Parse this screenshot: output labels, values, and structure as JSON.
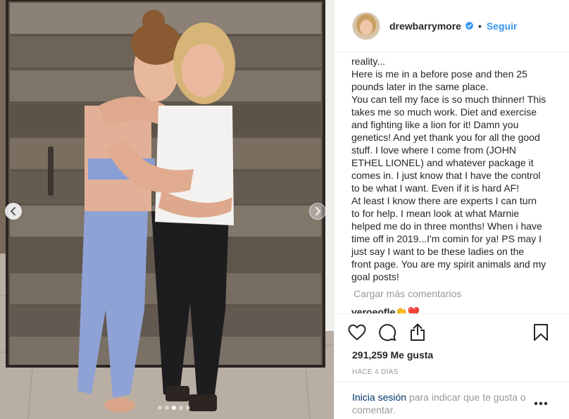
{
  "post": {
    "author": {
      "username": "drewbarrymore",
      "verified": true,
      "follow_label": "Seguir",
      "separator": "•"
    },
    "caption_lines": [
      "reality...",
      "Here is me in a before pose and then 25",
      "pounds later in the same place.",
      "You can tell my face is so much thinner! This",
      "takes me so much work. Diet and exercise",
      "and fighting like a lion for it! Damn you",
      "genetics! And yet thank you for all the good",
      "stuff. I love where I come from (JOHN",
      "ETHEL LIONEL) and whatever package it",
      "comes in. I just know that I have the control",
      "to be what I want. Even if it is hard AF!",
      "At least I know there are experts I can turn",
      "to for help. I mean look at what Marnie",
      "helped me do in three months! When i have",
      "time off in 2019...I'm comin for ya! PS may I",
      "just say I want to be these ladies on the",
      "front page. You are my spirit animals and my",
      "goal posts!"
    ],
    "load_more_label": "Cargar más comentarios",
    "next_comment": {
      "username": "veroeofle",
      "emoji": "👏❤️"
    },
    "likes_label": "291,259 Me gusta",
    "time_label": "HACE 4 DÍAS",
    "login_link": "Inicia sesión",
    "login_rest": " para indicar que te gusta o comentar.",
    "carousel": {
      "slide_count": 5,
      "active_index": 2
    }
  },
  "icons": {
    "like": "heart-outline-icon",
    "comment": "speech-bubble-icon",
    "share": "share-upload-icon",
    "save": "bookmark-icon",
    "more": "ellipsis-icon",
    "verified": "verified-badge-icon"
  },
  "colors": {
    "link": "#3897f0",
    "verified": "#3897f0",
    "text": "#262626",
    "muted": "#999999",
    "login_link": "#003569"
  }
}
